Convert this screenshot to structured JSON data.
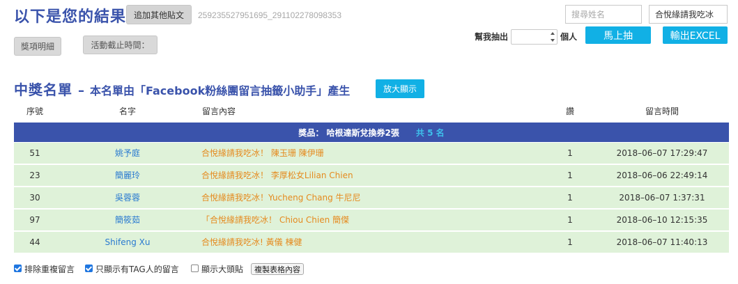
{
  "header": {
    "title": "以下是您的結果",
    "add_post_button": "追加其他貼文",
    "post_id": "259235527951695_291102278098353",
    "prize_detail_button": "獎項明細",
    "deadline_button": "活動截止時間："
  },
  "controls": {
    "search_placeholder": "搜尋姓名",
    "keyword_value": "合悅緣請我吃冰",
    "draw_label_prefix": "幫我抽出",
    "draw_label_suffix": "個人",
    "draw_now_button": "馬上抽",
    "export_button": "輸出EXCEL"
  },
  "winners": {
    "title": "中獎名單",
    "dash": "–",
    "subtitle": "本名單由「Facebook粉絲團留言抽籤小助手」產生",
    "zoom_button": "放大顯示",
    "columns": [
      "序號",
      "名字",
      "留言內容",
      "讚",
      "留言時間"
    ],
    "prize_label": "獎品： 哈根達斯兌換券2張",
    "prize_count": "共 5 名",
    "rows": [
      {
        "idx": "51",
        "name": "姚予庭",
        "message": "合悅緣請我吃冰！ 陳玉珊 陳伊珊",
        "likes": "1",
        "time": "2018–06–07 17:29:47"
      },
      {
        "idx": "23",
        "name": "簡麗玲",
        "message": "合悅緣請我吃冰！ 李厚松女Lilian Chien",
        "likes": "1",
        "time": "2018–06–06 22:49:14"
      },
      {
        "idx": "30",
        "name": "吳蓉蓉",
        "message": "合悅緣請我吃冰！Yucheng Chang 牛尼尼",
        "likes": "1",
        "time": "2018–06–07 1:37:31"
      },
      {
        "idx": "97",
        "name": "簡筱茹",
        "message": "「合悅緣請我吃冰！ Chiou Chien 簡傑",
        "likes": "1",
        "time": "2018–06–10 12:15:35"
      },
      {
        "idx": "44",
        "name": "Shifeng Xu",
        "message": "合悅緣請我吃冰! 黃儀 楝健",
        "likes": "1",
        "time": "2018–06–07 11:40:13"
      }
    ]
  },
  "options": {
    "exclude_duplicates": {
      "label": "排除重複留言",
      "checked": true
    },
    "only_tagged": {
      "label": "只顯示有TAG人的留言",
      "checked": true
    },
    "show_avatars": {
      "label": "顯示大頭貼",
      "checked": false
    },
    "copy_table_button": "複製表格內容"
  },
  "colors": {
    "title_blue": "#3a53ab",
    "prize_bar_bg": "#3a53ab",
    "prize_count": "#3ec1ec",
    "row_bg": "#dff2d9",
    "name_link": "#2a7ad0",
    "message_orange": "#e58a1e",
    "cyan_button": "#11b0e5",
    "checkbox_blue": "#1f76e0"
  }
}
